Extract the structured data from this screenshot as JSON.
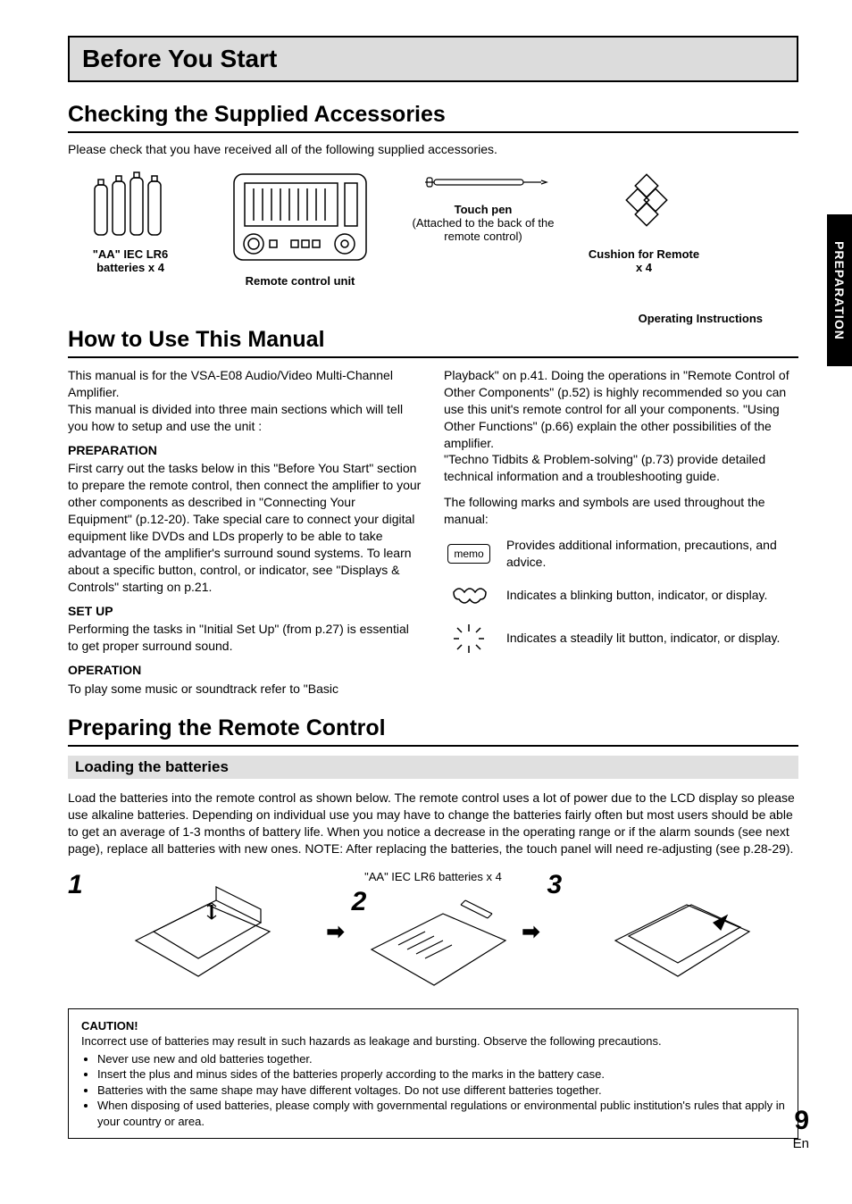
{
  "chapter_title": "Before You Start",
  "side_tab": "PREPARATION",
  "page_number": "9",
  "page_lang": "En",
  "sections": {
    "accessories": {
      "heading": "Checking the Supplied Accessories",
      "intro": "Please check that you have received all of the following supplied accessories.",
      "items": {
        "batteries": {
          "label": "\"AA\" IEC LR6 batteries x 4"
        },
        "remote": {
          "label": "Remote control unit"
        },
        "touchpen": {
          "label": "Touch pen",
          "sub": "(Attached to the back of the remote control)"
        },
        "cushion": {
          "label": "Cushion for Remote x 4"
        },
        "op_inst": {
          "label": "Operating Instructions"
        }
      }
    },
    "howto": {
      "heading": "How to Use This Manual",
      "col1": {
        "p1": "This manual is for the VSA-E08 Audio/Video Multi-Channel Amplifier.",
        "p2": "This manual is divided into three main sections which will tell you how to setup and use the unit :",
        "prep_head": "PREPARATION",
        "prep_body": "First carry out the tasks below in this \"Before You Start\" section to prepare the remote control, then connect the amplifier to your other components as described in \"Connecting Your Equipment\" (p.12-20). Take special care to connect your digital equipment like DVDs and LDs properly to be able to take advantage of the amplifier's surround sound systems. To learn about a specific button, control, or indicator, see \"Displays & Controls\" starting on p.21.",
        "setup_head": "SET UP",
        "setup_body": "Performing the tasks in \"Initial Set Up\" (from p.27) is essential to get proper surround sound.",
        "op_head": "OPERATION",
        "op_body": "To play some music or soundtrack refer to \"Basic"
      },
      "col2": {
        "p1": "Playback\" on p.41. Doing the operations in \"Remote Control of Other Components\" (p.52) is highly recommended so you can use this unit's remote control for all your components.  \"Using Other Functions\" (p.66) explain the other possibilities of the amplifier.",
        "p2": "\"Techno Tidbits & Problem-solving\" (p.73) provide detailed technical information and a troubleshooting guide.",
        "p3": "The following marks and symbols are used throughout the manual:",
        "memo_label": "memo",
        "memo_desc": "Provides additional information, precautions, and advice.",
        "blink_desc": "Indicates a blinking button, indicator, or display.",
        "steady_desc": "Indicates a steadily lit button, indicator, or display."
      }
    },
    "remote": {
      "heading": "Preparing the Remote Control",
      "sub_heading": "Loading the batteries",
      "body": "Load the batteries into the remote control as shown below. The remote control uses a lot of power due to the LCD display so please use alkaline batteries. Depending on individual use you may have to change the batteries fairly often but most users should be able to get an average of 1-3 months of battery life. When you notice a decrease in the operating range or if the alarm sounds (see next page), replace all batteries with new ones. NOTE: After replacing the batteries, the touch panel will need re-adjusting (see p.28-29).",
      "steps": {
        "n1": "1",
        "n2": "2",
        "n3": "3",
        "step2_label": "\"AA\" IEC LR6 batteries x 4"
      },
      "caution": {
        "title": "CAUTION!",
        "intro": "Incorrect use of batteries may result in such hazards as leakage and bursting. Observe the following precautions.",
        "bullets": [
          "Never use new and old batteries together.",
          "Insert the plus and minus sides of the batteries properly according to the marks in the battery case.",
          "Batteries with the same shape may have different voltages. Do not use different batteries together.",
          "When disposing of used batteries, please comply with governmental regulations or environmental public institution's rules that apply in your country or area."
        ]
      }
    }
  }
}
